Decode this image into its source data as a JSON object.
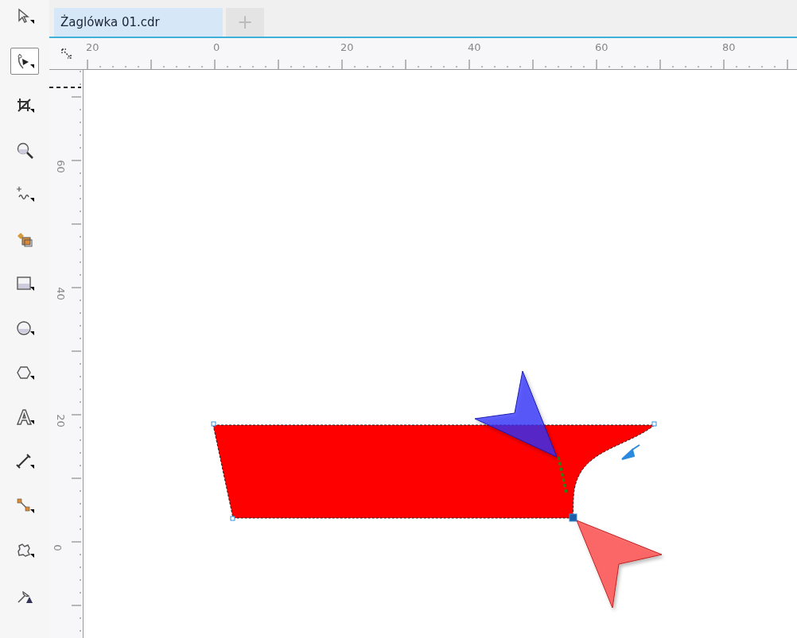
{
  "tools": [
    {
      "kind": "pick",
      "selected": false
    },
    {
      "kind": "shape",
      "selected": true
    },
    {
      "kind": "crop",
      "selected": false
    },
    {
      "kind": "zoom",
      "selected": false
    },
    {
      "kind": "freehand",
      "selected": false
    },
    {
      "kind": "smartfill",
      "selected": false
    },
    {
      "kind": "rectangle",
      "selected": false
    },
    {
      "kind": "ellipse",
      "selected": false
    },
    {
      "kind": "polygon",
      "selected": false
    },
    {
      "kind": "text",
      "selected": false
    },
    {
      "kind": "dimension",
      "selected": false
    },
    {
      "kind": "connector",
      "selected": false
    },
    {
      "kind": "blend",
      "selected": false
    },
    {
      "kind": "eyedropper",
      "selected": false
    }
  ],
  "tabs": [
    {
      "label": "Żaglówka 01.cdr",
      "selected": true
    }
  ],
  "new_tab": "+",
  "horizontal_ruler": [
    "20",
    "0",
    "20",
    "40",
    "60",
    "80"
  ],
  "vertical_ruler": [
    "60",
    "40",
    "20",
    "0"
  ]
}
